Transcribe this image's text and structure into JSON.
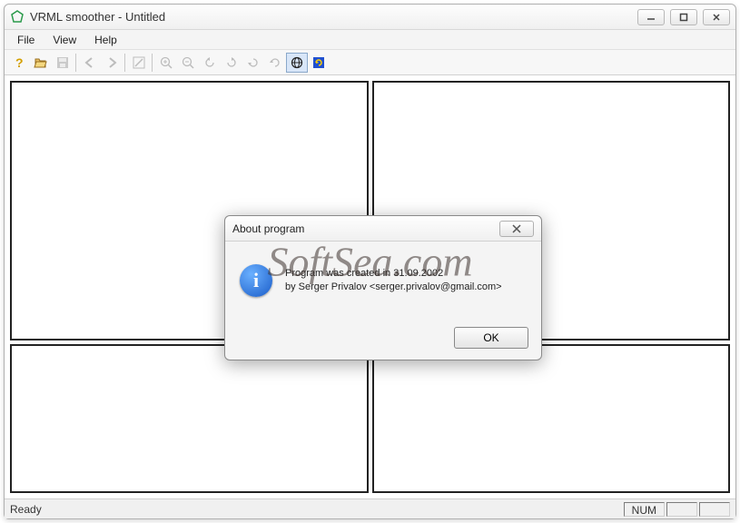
{
  "window": {
    "title": "VRML smoother - Untitled"
  },
  "menu": {
    "file": "File",
    "view": "View",
    "help": "Help"
  },
  "status": {
    "ready": "Ready",
    "num": "NUM"
  },
  "dialog": {
    "title": "About program",
    "line1": "Program was created in 31.09.2002",
    "line2": "by Serger Privalov <serger.privalov@gmail.com>",
    "ok": "OK"
  },
  "watermark": "SoftSea.com"
}
